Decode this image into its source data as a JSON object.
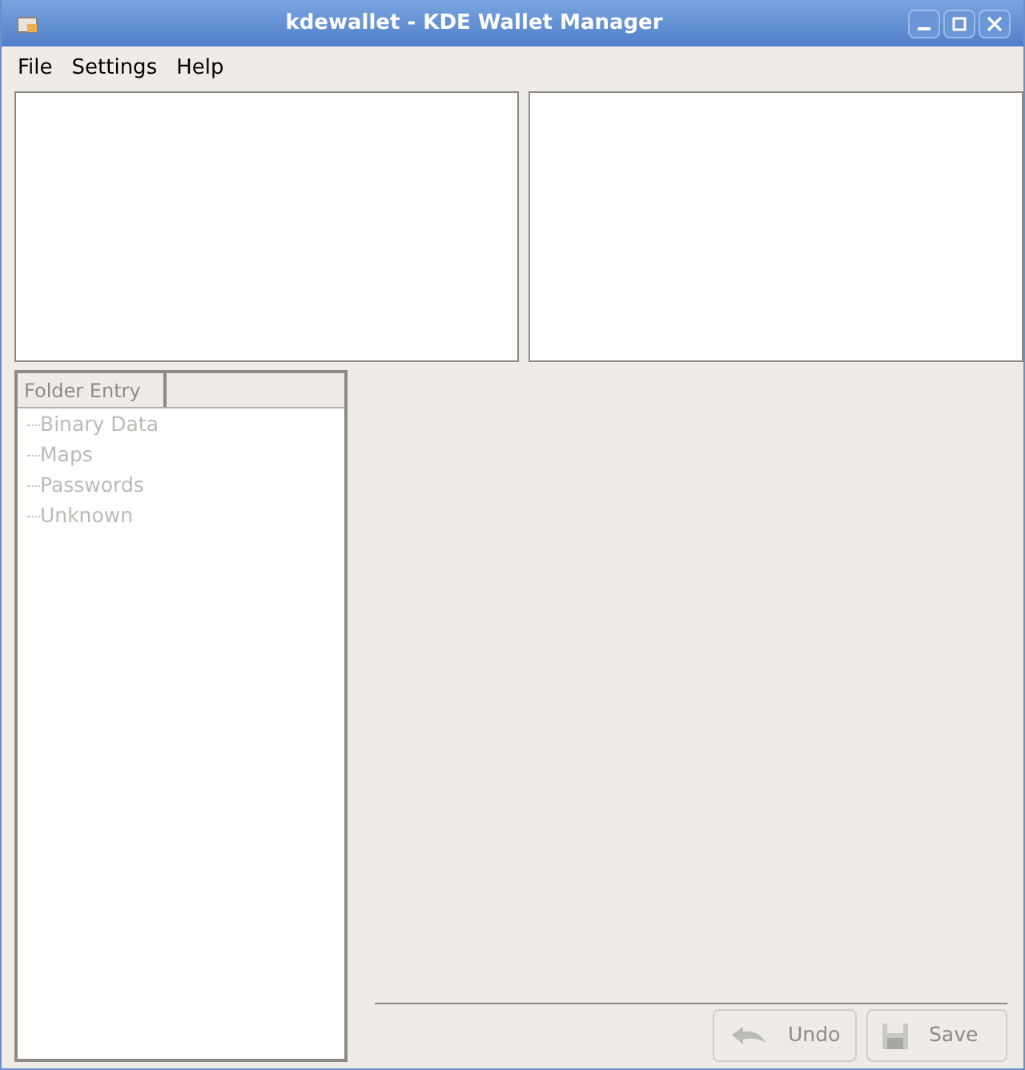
{
  "window": {
    "title": "kdewallet - KDE Wallet Manager"
  },
  "menu": [
    "File",
    "Settings",
    "Help"
  ],
  "tree": {
    "disabled": true,
    "columns": [
      "Folder Entry"
    ],
    "items": [
      {
        "label": "Binary Data"
      },
      {
        "label": "Maps"
      },
      {
        "label": "Passwords"
      },
      {
        "label": "Unknown"
      }
    ]
  },
  "buttons": [
    {
      "kind": "undo",
      "label": "Undo",
      "disabled": true
    },
    {
      "kind": "save",
      "label": "Save",
      "disabled": true
    }
  ]
}
